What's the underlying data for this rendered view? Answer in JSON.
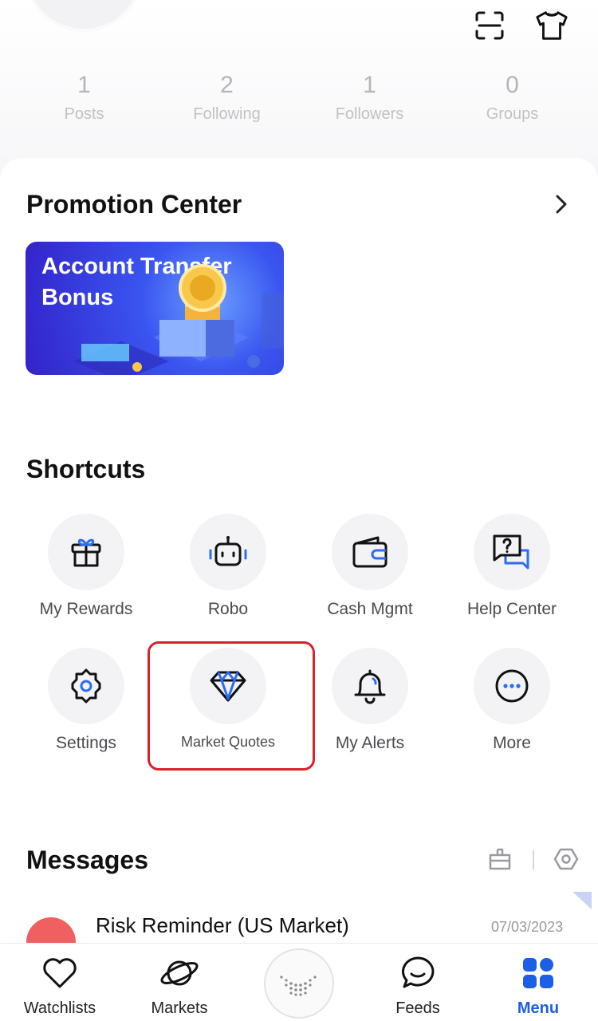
{
  "stats": [
    {
      "value": "1",
      "label": "Posts"
    },
    {
      "value": "2",
      "label": "Following"
    },
    {
      "value": "1",
      "label": "Followers"
    },
    {
      "value": "0",
      "label": "Groups"
    }
  ],
  "promotion": {
    "title": "Promotion Center",
    "banner_title": "Account Transfer Bonus"
  },
  "shortcuts": {
    "title": "Shortcuts",
    "items": [
      {
        "label": "My Rewards",
        "icon": "gift-icon"
      },
      {
        "label": "Robo",
        "icon": "robot-icon"
      },
      {
        "label": "Cash Mgmt",
        "icon": "wallet-icon"
      },
      {
        "label": "Help Center",
        "icon": "help-chat-icon"
      },
      {
        "label": "Settings",
        "icon": "gear-icon"
      },
      {
        "label": "Market Quotes",
        "icon": "diamond-icon"
      },
      {
        "label": "My Alerts",
        "icon": "bell-icon"
      },
      {
        "label": "More",
        "icon": "more-dots-icon"
      }
    ]
  },
  "messages": {
    "title": "Messages",
    "items": [
      {
        "title": "Risk Reminder (US Market)",
        "date": "07/03/2023"
      }
    ]
  },
  "tabbar": {
    "items": [
      {
        "label": "Watchlists",
        "icon": "heart-icon"
      },
      {
        "label": "Markets",
        "icon": "planet-icon"
      },
      {
        "label": "Feeds",
        "icon": "chat-bubble-icon"
      },
      {
        "label": "Menu",
        "icon": "grid-icon",
        "active": true
      }
    ]
  },
  "colors": {
    "accent": "#1d5ee8",
    "highlight": "#d8222c",
    "banner": "#3a55f0"
  }
}
